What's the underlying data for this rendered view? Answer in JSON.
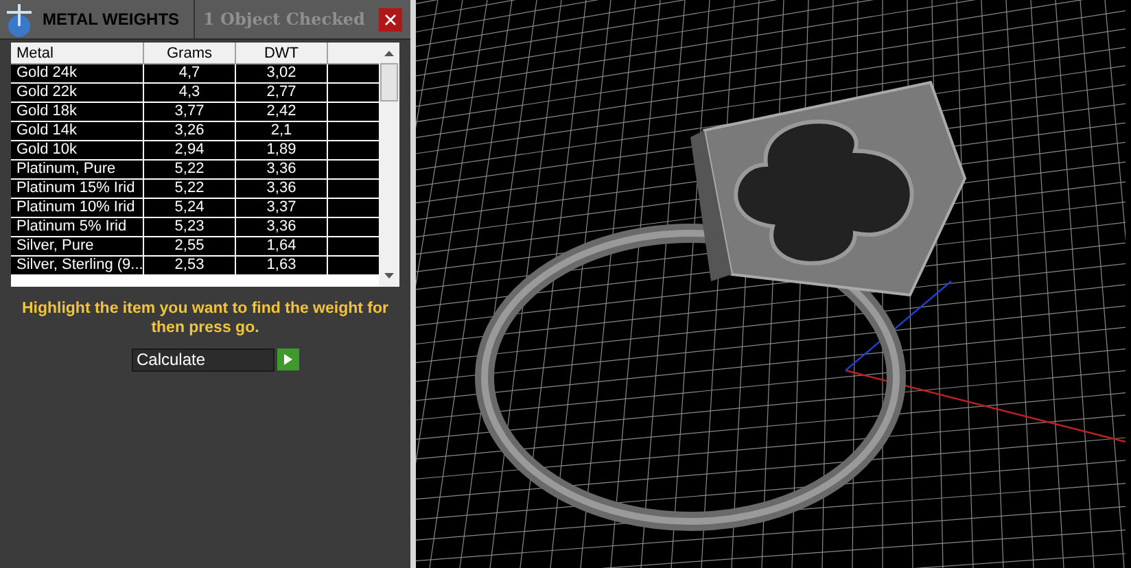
{
  "panel": {
    "title": "METAL WEIGHTS",
    "status": "1 Object Checked"
  },
  "table": {
    "columns": [
      "Metal",
      "Grams",
      "DWT"
    ],
    "rows": [
      {
        "metal": "Gold 24k",
        "grams": "4,7",
        "dwt": "3,02"
      },
      {
        "metal": "Gold 22k",
        "grams": "4,3",
        "dwt": "2,77"
      },
      {
        "metal": "Gold 18k",
        "grams": "3,77",
        "dwt": "2,42"
      },
      {
        "metal": "Gold 14k",
        "grams": "3,26",
        "dwt": "2,1"
      },
      {
        "metal": "Gold 10k",
        "grams": "2,94",
        "dwt": "1,89"
      },
      {
        "metal": "Platinum, Pure",
        "grams": "5,22",
        "dwt": "3,36"
      },
      {
        "metal": "Platinum 15% Irid",
        "grams": "5,22",
        "dwt": "3,36"
      },
      {
        "metal": "Platinum 10% Irid",
        "grams": "5,24",
        "dwt": "3,37"
      },
      {
        "metal": "Platinum 5% Irid",
        "grams": "5,23",
        "dwt": "3,36"
      },
      {
        "metal": "Silver, Pure",
        "grams": "2,55",
        "dwt": "1,64"
      },
      {
        "metal": "Silver, Sterling (9...",
        "grams": "2,53",
        "dwt": "1,63"
      }
    ]
  },
  "instruction": "Highlight the item you want to find the weight for then press go.",
  "action": {
    "value": "Calculate"
  }
}
